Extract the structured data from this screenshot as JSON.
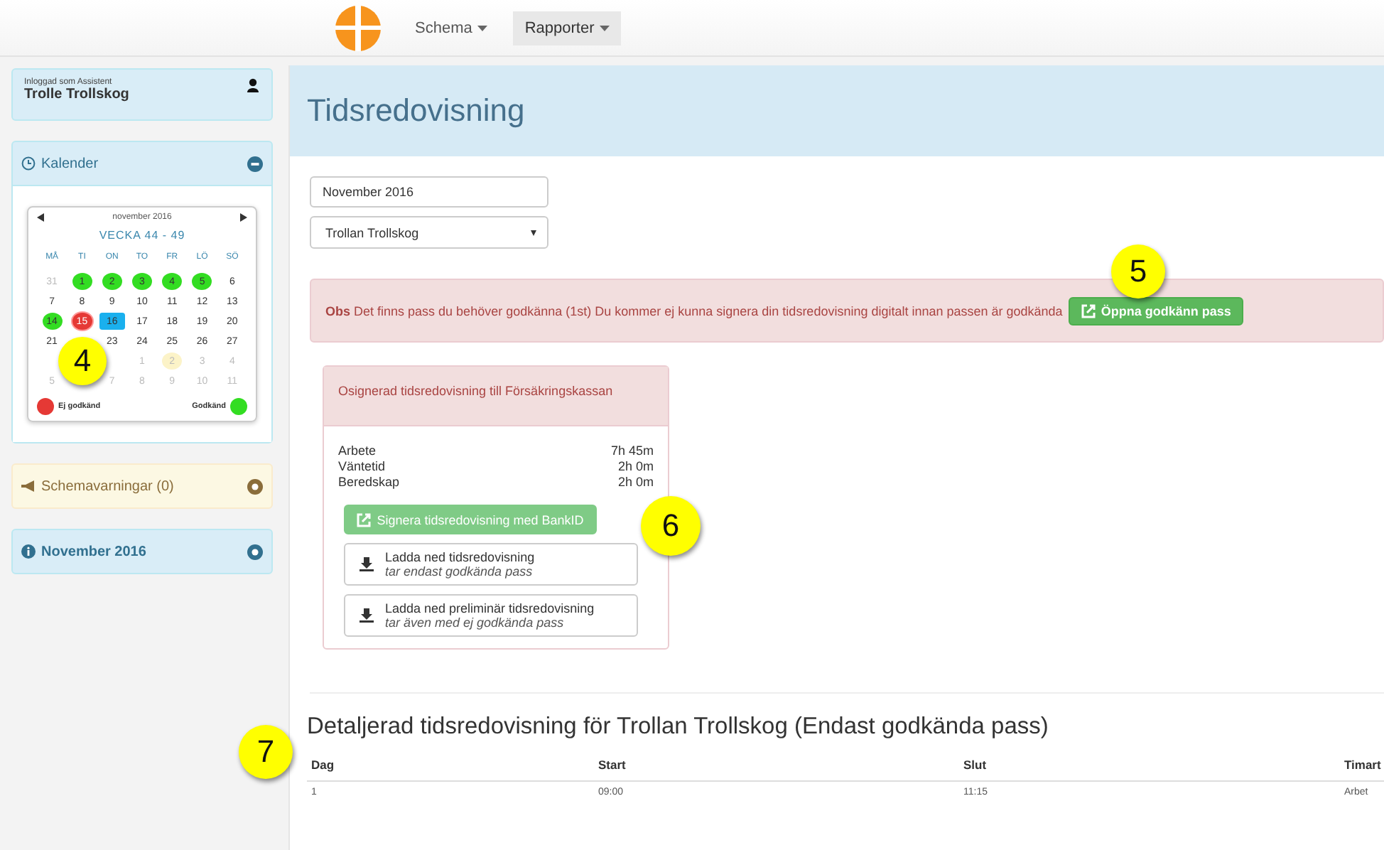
{
  "navbar": {
    "menus": [
      {
        "label": "Schema",
        "selected": false
      },
      {
        "label": "Rapporter",
        "selected": true
      }
    ]
  },
  "sidebar": {
    "user": {
      "caption": "Inloggad som Assistent",
      "name": "Trolle Trollskog"
    },
    "calendar": {
      "title": "Kalender",
      "expanded": true,
      "month": "november 2016",
      "week": "VECKA 44 - 49",
      "weekdays": [
        "MÅ",
        "TI",
        "ON",
        "TO",
        "FR",
        "LÖ",
        "SÖ"
      ],
      "weeks": [
        [
          {
            "day": "31",
            "kind": "other"
          },
          {
            "day": "1",
            "kind": "approved"
          },
          {
            "day": "2",
            "kind": "approved"
          },
          {
            "day": "3",
            "kind": "approved"
          },
          {
            "day": "4",
            "kind": "approved"
          },
          {
            "day": "5",
            "kind": "approved"
          },
          {
            "day": "6",
            "kind": "normal"
          }
        ],
        [
          {
            "day": "7",
            "kind": "normal"
          },
          {
            "day": "8",
            "kind": "normal"
          },
          {
            "day": "9",
            "kind": "normal"
          },
          {
            "day": "10",
            "kind": "normal"
          },
          {
            "day": "11",
            "kind": "normal"
          },
          {
            "day": "12",
            "kind": "normal"
          },
          {
            "day": "13",
            "kind": "normal"
          }
        ],
        [
          {
            "day": "14",
            "kind": "approved"
          },
          {
            "day": "15",
            "kind": "rejected"
          },
          {
            "day": "16",
            "kind": "today"
          },
          {
            "day": "17",
            "kind": "normal"
          },
          {
            "day": "18",
            "kind": "normal"
          },
          {
            "day": "19",
            "kind": "normal"
          },
          {
            "day": "20",
            "kind": "normal"
          }
        ],
        [
          {
            "day": "21",
            "kind": "normal"
          },
          {
            "kind": "covered"
          },
          {
            "day": "23",
            "kind": "normal"
          },
          {
            "day": "24",
            "kind": "normal"
          },
          {
            "day": "25",
            "kind": "normal"
          },
          {
            "day": "26",
            "kind": "normal"
          },
          {
            "day": "27",
            "kind": "normal"
          }
        ],
        [
          {
            "kind": "covered"
          },
          {
            "kind": "covered"
          },
          {
            "kind": "covered"
          },
          {
            "day": "1",
            "kind": "other"
          },
          {
            "day": "2",
            "kind": "pending"
          },
          {
            "day": "3",
            "kind": "other"
          },
          {
            "day": "4",
            "kind": "other"
          }
        ],
        [
          {
            "day": "5",
            "kind": "other"
          },
          {
            "kind": "covered"
          },
          {
            "day": "7",
            "kind": "other"
          },
          {
            "day": "8",
            "kind": "other"
          },
          {
            "day": "9",
            "kind": "other"
          },
          {
            "day": "10",
            "kind": "other"
          },
          {
            "day": "11",
            "kind": "other"
          }
        ]
      ],
      "legend": [
        {
          "label": "Ej godkänd",
          "color": "#e53935"
        },
        {
          "label": "Godkänd",
          "color": "#33dd22"
        }
      ]
    },
    "panels": [
      {
        "kind": "warning",
        "title": "Schemavarningar (0)",
        "expanded": false
      },
      {
        "kind": "info",
        "title": "November 2016",
        "expanded": false
      }
    ]
  },
  "main": {
    "title": "Tidsredovisning",
    "month_field": "November 2016",
    "person_select": "Trollan Trollskog",
    "alert": {
      "label": "Obs",
      "text": "Det finns pass du behöver godkänna (1st) Du kommer ej kunna signera din tidsredovisning digitalt innan passen är godkända",
      "button": "Öppna godkänn pass"
    },
    "summary": {
      "title": "Osignerad tidsredovisning till Försäkringskassan",
      "rows": [
        {
          "label": "Arbete",
          "value": "7h 45m"
        },
        {
          "label": "Väntetid",
          "value": "2h 0m"
        },
        {
          "label": "Beredskap",
          "value": "2h 0m"
        }
      ],
      "sign_button": {
        "label": "Signera tidsredovisning med BankID",
        "disabled": true
      },
      "downloads": [
        {
          "title": "Ladda ned tidsredovisning",
          "subtitle": "tar endast godkända pass"
        },
        {
          "title": "Ladda ned preliminär tidsredovisning",
          "subtitle": "tar även med ej godkända pass"
        }
      ]
    },
    "detail": {
      "title": "Detaljerad tidsredovisning för Trollan Trollskog (Endast godkända pass)",
      "columns": [
        "Dag",
        "Start",
        "Slut",
        "Timart"
      ],
      "rows": [
        [
          "1",
          "09:00",
          "11:15",
          "Arbet"
        ]
      ]
    }
  },
  "callouts": [
    "4",
    "5",
    "6",
    "7"
  ]
}
